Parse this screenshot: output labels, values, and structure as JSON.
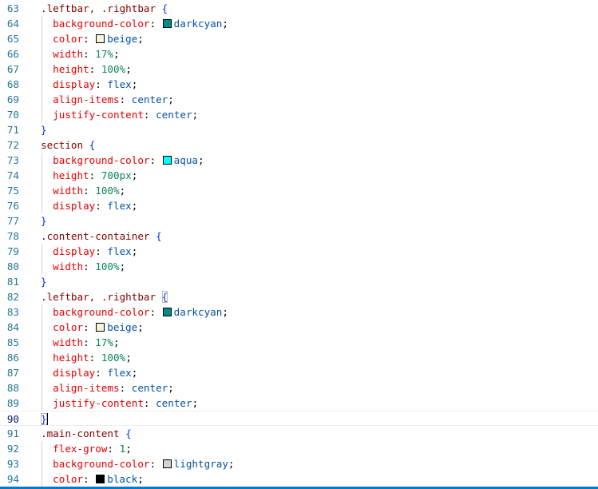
{
  "editor": {
    "language": "css",
    "active_line": "90",
    "accent_color": "#007acc"
  },
  "lines": [
    {
      "n": "63",
      "tokens": [
        {
          "t": ".leftbar, .rightbar",
          "c": "sel"
        },
        {
          "t": " ",
          "c": "pun"
        },
        {
          "t": "{",
          "c": "brace"
        }
      ]
    },
    {
      "n": "64",
      "tokens": [
        {
          "t": "  ",
          "c": "pun"
        },
        {
          "t": "background-color",
          "c": "prop"
        },
        {
          "t": ": ",
          "c": "pun"
        },
        {
          "sw": "#008b8b"
        },
        {
          "t": "darkcyan",
          "c": "val"
        },
        {
          "t": ";",
          "c": "pun"
        }
      ]
    },
    {
      "n": "65",
      "tokens": [
        {
          "t": "  ",
          "c": "pun"
        },
        {
          "t": "color",
          "c": "prop"
        },
        {
          "t": ": ",
          "c": "pun"
        },
        {
          "sw": "#f5f5dc"
        },
        {
          "t": "beige",
          "c": "val"
        },
        {
          "t": ";",
          "c": "pun"
        }
      ]
    },
    {
      "n": "66",
      "tokens": [
        {
          "t": "  ",
          "c": "pun"
        },
        {
          "t": "width",
          "c": "prop"
        },
        {
          "t": ": ",
          "c": "pun"
        },
        {
          "t": "17%",
          "c": "num"
        },
        {
          "t": ";",
          "c": "pun"
        }
      ]
    },
    {
      "n": "67",
      "tokens": [
        {
          "t": "  ",
          "c": "pun"
        },
        {
          "t": "height",
          "c": "prop"
        },
        {
          "t": ": ",
          "c": "pun"
        },
        {
          "t": "100%",
          "c": "num"
        },
        {
          "t": ";",
          "c": "pun"
        }
      ]
    },
    {
      "n": "68",
      "tokens": [
        {
          "t": "  ",
          "c": "pun"
        },
        {
          "t": "display",
          "c": "prop"
        },
        {
          "t": ": ",
          "c": "pun"
        },
        {
          "t": "flex",
          "c": "val"
        },
        {
          "t": ";",
          "c": "pun"
        }
      ]
    },
    {
      "n": "69",
      "tokens": [
        {
          "t": "  ",
          "c": "pun"
        },
        {
          "t": "align-items",
          "c": "prop"
        },
        {
          "t": ": ",
          "c": "pun"
        },
        {
          "t": "center",
          "c": "val"
        },
        {
          "t": ";",
          "c": "pun"
        }
      ]
    },
    {
      "n": "70",
      "tokens": [
        {
          "t": "  ",
          "c": "pun"
        },
        {
          "t": "justify-content",
          "c": "prop"
        },
        {
          "t": ": ",
          "c": "pun"
        },
        {
          "t": "center",
          "c": "val"
        },
        {
          "t": ";",
          "c": "pun"
        }
      ]
    },
    {
      "n": "71",
      "tokens": [
        {
          "t": "}",
          "c": "brace"
        }
      ]
    },
    {
      "n": "72",
      "tokens": [
        {
          "t": "section",
          "c": "sel"
        },
        {
          "t": " ",
          "c": "pun"
        },
        {
          "t": "{",
          "c": "brace"
        }
      ]
    },
    {
      "n": "73",
      "tokens": [
        {
          "t": "  ",
          "c": "pun"
        },
        {
          "t": "background-color",
          "c": "prop"
        },
        {
          "t": ": ",
          "c": "pun"
        },
        {
          "sw": "#00ffff"
        },
        {
          "t": "aqua",
          "c": "val"
        },
        {
          "t": ";",
          "c": "pun"
        }
      ]
    },
    {
      "n": "74",
      "tokens": [
        {
          "t": "  ",
          "c": "pun"
        },
        {
          "t": "height",
          "c": "prop"
        },
        {
          "t": ": ",
          "c": "pun"
        },
        {
          "t": "700px",
          "c": "num"
        },
        {
          "t": ";",
          "c": "pun"
        }
      ]
    },
    {
      "n": "75",
      "tokens": [
        {
          "t": "  ",
          "c": "pun"
        },
        {
          "t": "width",
          "c": "prop"
        },
        {
          "t": ": ",
          "c": "pun"
        },
        {
          "t": "100%",
          "c": "num"
        },
        {
          "t": ";",
          "c": "pun"
        }
      ]
    },
    {
      "n": "76",
      "tokens": [
        {
          "t": "  ",
          "c": "pun"
        },
        {
          "t": "display",
          "c": "prop"
        },
        {
          "t": ": ",
          "c": "pun"
        },
        {
          "t": "flex",
          "c": "val"
        },
        {
          "t": ";",
          "c": "pun"
        }
      ]
    },
    {
      "n": "77",
      "tokens": [
        {
          "t": "}",
          "c": "brace"
        }
      ]
    },
    {
      "n": "78",
      "tokens": [
        {
          "t": ".content-container",
          "c": "sel"
        },
        {
          "t": " ",
          "c": "pun"
        },
        {
          "t": "{",
          "c": "brace"
        }
      ]
    },
    {
      "n": "79",
      "tokens": [
        {
          "t": "  ",
          "c": "pun"
        },
        {
          "t": "display",
          "c": "prop"
        },
        {
          "t": ": ",
          "c": "pun"
        },
        {
          "t": "flex",
          "c": "val"
        },
        {
          "t": ";",
          "c": "pun"
        }
      ]
    },
    {
      "n": "80",
      "tokens": [
        {
          "t": "  ",
          "c": "pun"
        },
        {
          "t": "width",
          "c": "prop"
        },
        {
          "t": ": ",
          "c": "pun"
        },
        {
          "t": "100%",
          "c": "num"
        },
        {
          "t": ";",
          "c": "pun"
        }
      ]
    },
    {
      "n": "81",
      "tokens": [
        {
          "t": "}",
          "c": "brace"
        }
      ]
    },
    {
      "n": "82",
      "tokens": [
        {
          "t": ".leftbar, .rightbar",
          "c": "sel"
        },
        {
          "t": " ",
          "c": "pun"
        },
        {
          "t": "{",
          "c": "brace",
          "match": true
        }
      ]
    },
    {
      "n": "83",
      "tokens": [
        {
          "t": "  ",
          "c": "pun"
        },
        {
          "t": "background-color",
          "c": "prop"
        },
        {
          "t": ": ",
          "c": "pun"
        },
        {
          "sw": "#008b8b"
        },
        {
          "t": "darkcyan",
          "c": "val"
        },
        {
          "t": ";",
          "c": "pun"
        }
      ]
    },
    {
      "n": "84",
      "tokens": [
        {
          "t": "  ",
          "c": "pun"
        },
        {
          "t": "color",
          "c": "prop"
        },
        {
          "t": ": ",
          "c": "pun"
        },
        {
          "sw": "#f5f5dc"
        },
        {
          "t": "beige",
          "c": "val"
        },
        {
          "t": ";",
          "c": "pun"
        }
      ]
    },
    {
      "n": "85",
      "tokens": [
        {
          "t": "  ",
          "c": "pun"
        },
        {
          "t": "width",
          "c": "prop"
        },
        {
          "t": ": ",
          "c": "pun"
        },
        {
          "t": "17%",
          "c": "num"
        },
        {
          "t": ";",
          "c": "pun"
        }
      ]
    },
    {
      "n": "86",
      "tokens": [
        {
          "t": "  ",
          "c": "pun"
        },
        {
          "t": "height",
          "c": "prop"
        },
        {
          "t": ": ",
          "c": "pun"
        },
        {
          "t": "100%",
          "c": "num"
        },
        {
          "t": ";",
          "c": "pun"
        }
      ]
    },
    {
      "n": "87",
      "tokens": [
        {
          "t": "  ",
          "c": "pun"
        },
        {
          "t": "display",
          "c": "prop"
        },
        {
          "t": ": ",
          "c": "pun"
        },
        {
          "t": "flex",
          "c": "val"
        },
        {
          "t": ";",
          "c": "pun"
        }
      ]
    },
    {
      "n": "88",
      "tokens": [
        {
          "t": "  ",
          "c": "pun"
        },
        {
          "t": "align-items",
          "c": "prop"
        },
        {
          "t": ": ",
          "c": "pun"
        },
        {
          "t": "center",
          "c": "val"
        },
        {
          "t": ";",
          "c": "pun"
        }
      ]
    },
    {
      "n": "89",
      "tokens": [
        {
          "t": "  ",
          "c": "pun"
        },
        {
          "t": "justify-content",
          "c": "prop"
        },
        {
          "t": ": ",
          "c": "pun"
        },
        {
          "t": "center",
          "c": "val"
        },
        {
          "t": ";",
          "c": "pun"
        }
      ]
    },
    {
      "n": "90",
      "current": true,
      "tokens": [
        {
          "t": "}",
          "c": "brace",
          "match": true
        },
        {
          "cursor": true
        }
      ]
    },
    {
      "n": "91",
      "tokens": [
        {
          "t": ".main-content",
          "c": "sel"
        },
        {
          "t": " ",
          "c": "pun"
        },
        {
          "t": "{",
          "c": "brace"
        }
      ]
    },
    {
      "n": "92",
      "tokens": [
        {
          "t": "  ",
          "c": "pun"
        },
        {
          "t": "flex-grow",
          "c": "prop"
        },
        {
          "t": ": ",
          "c": "pun"
        },
        {
          "t": "1",
          "c": "num"
        },
        {
          "t": ";",
          "c": "pun"
        }
      ]
    },
    {
      "n": "93",
      "tokens": [
        {
          "t": "  ",
          "c": "pun"
        },
        {
          "t": "background-color",
          "c": "prop"
        },
        {
          "t": ": ",
          "c": "pun"
        },
        {
          "sw": "#d3d3d3"
        },
        {
          "t": "lightgray",
          "c": "val"
        },
        {
          "t": ";",
          "c": "pun"
        }
      ]
    },
    {
      "n": "94",
      "tokens": [
        {
          "t": "  ",
          "c": "pun"
        },
        {
          "t": "color",
          "c": "prop"
        },
        {
          "t": ": ",
          "c": "pun"
        },
        {
          "sw": "#000000"
        },
        {
          "t": "black",
          "c": "val"
        },
        {
          "t": ";",
          "c": "pun"
        }
      ]
    }
  ]
}
